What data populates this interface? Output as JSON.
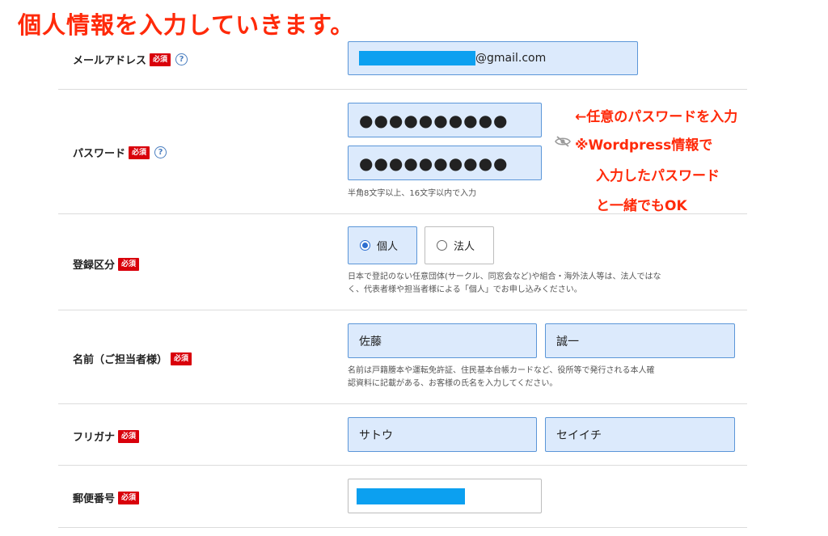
{
  "annotation_title": "個人情報を入力していきます。",
  "email": {
    "label": "メールアドレス",
    "required": "必須",
    "help": "?",
    "value_suffix": "@gmail.com"
  },
  "password": {
    "label": "パスワード",
    "required": "必須",
    "help": "?",
    "value": "●●●●●●●●●●",
    "confirm_value": "●●●●●●●●●●",
    "hint": "半角8文字以上、16文字以内で入力"
  },
  "password_annotation": {
    "line1": "←任意のパスワードを入力",
    "line2": "※Wordpress情報で",
    "line3": "入力したパスワード",
    "line4": "と一緒でもOK"
  },
  "registration_type": {
    "label": "登録区分",
    "required": "必須",
    "options": [
      "個人",
      "法人"
    ],
    "selected": "個人",
    "hint_line1": "日本で登記のない任意団体(サークル、同窓会など)や組合・海外法人等は、法人ではな",
    "hint_line2": "く、代表者様や担当者様による「個人」でお申し込みください。"
  },
  "name": {
    "label": "名前（ご担当者様）",
    "required": "必須",
    "last": "佐藤",
    "first": "誠一",
    "hint_line1": "名前は戸籍謄本や運転免許証、住民基本台帳カードなど、役所等で発行される本人確",
    "hint_line2": "認資料に記載がある、お客様の氏名を入力してください。"
  },
  "furigana": {
    "label": "フリガナ",
    "required": "必須",
    "last": "サトウ",
    "first": "セイイチ"
  },
  "postal": {
    "label": "郵便番号",
    "required": "必須"
  },
  "colors": {
    "annotation": "#ff2a0a",
    "required_badge": "#d9000b",
    "field_fill": "#dceafc",
    "field_border": "#5b96d8",
    "redaction": "#0ca0f0"
  },
  "icons": {
    "help": "question-circle-icon",
    "password_toggle": "eye-slash-icon",
    "radio": "radio-icon"
  }
}
